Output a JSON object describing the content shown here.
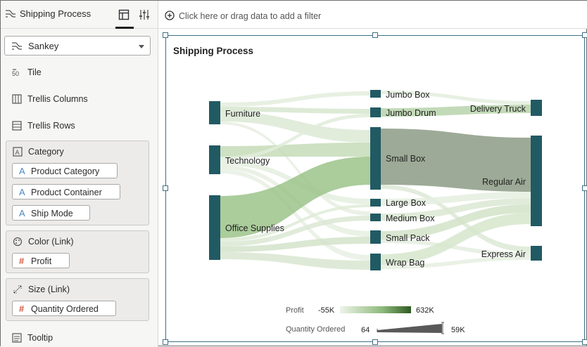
{
  "panel": {
    "title": "Shipping Process",
    "viz_type": "Sankey",
    "items": {
      "tile": "Tile",
      "trellis_columns": "Trellis Columns",
      "trellis_rows": "Trellis Rows",
      "tooltip": "Tooltip"
    },
    "groups": {
      "category": {
        "label": "Category",
        "pills": [
          "Product Category",
          "Product Container",
          "Ship Mode"
        ]
      },
      "color": {
        "label": "Color (Link)",
        "pills": [
          "Profit"
        ]
      },
      "size": {
        "label": "Size (Link)",
        "pills": [
          "Quantity Ordered"
        ]
      }
    }
  },
  "filter_bar": {
    "text": "Click here or drag data to add a filter"
  },
  "viz": {
    "title": "Shipping Process",
    "nodes": {
      "category": [
        "Furniture",
        "Technology",
        "Office Supplies"
      ],
      "container": [
        "Jumbo Box",
        "Jumbo Drum",
        "Small Box",
        "Large Box",
        "Medium Box",
        "Small Pack",
        "Wrap Bag"
      ],
      "ship_mode": [
        "Delivery Truck",
        "Regular Air",
        "Express Air"
      ]
    },
    "legend": {
      "profit_label": "Profit",
      "profit_min": "-55K",
      "profit_max": "632K",
      "qty_label": "Quantity Ordered",
      "qty_min": "64",
      "qty_max": "59K"
    }
  },
  "colors": {
    "node": "#215a63",
    "link_light": "#e3eddd",
    "link_mid": "#b9d3ab",
    "link_strong": "#9cc38a",
    "link_gray": "#8c9b85",
    "accent": "#3e6e86"
  }
}
